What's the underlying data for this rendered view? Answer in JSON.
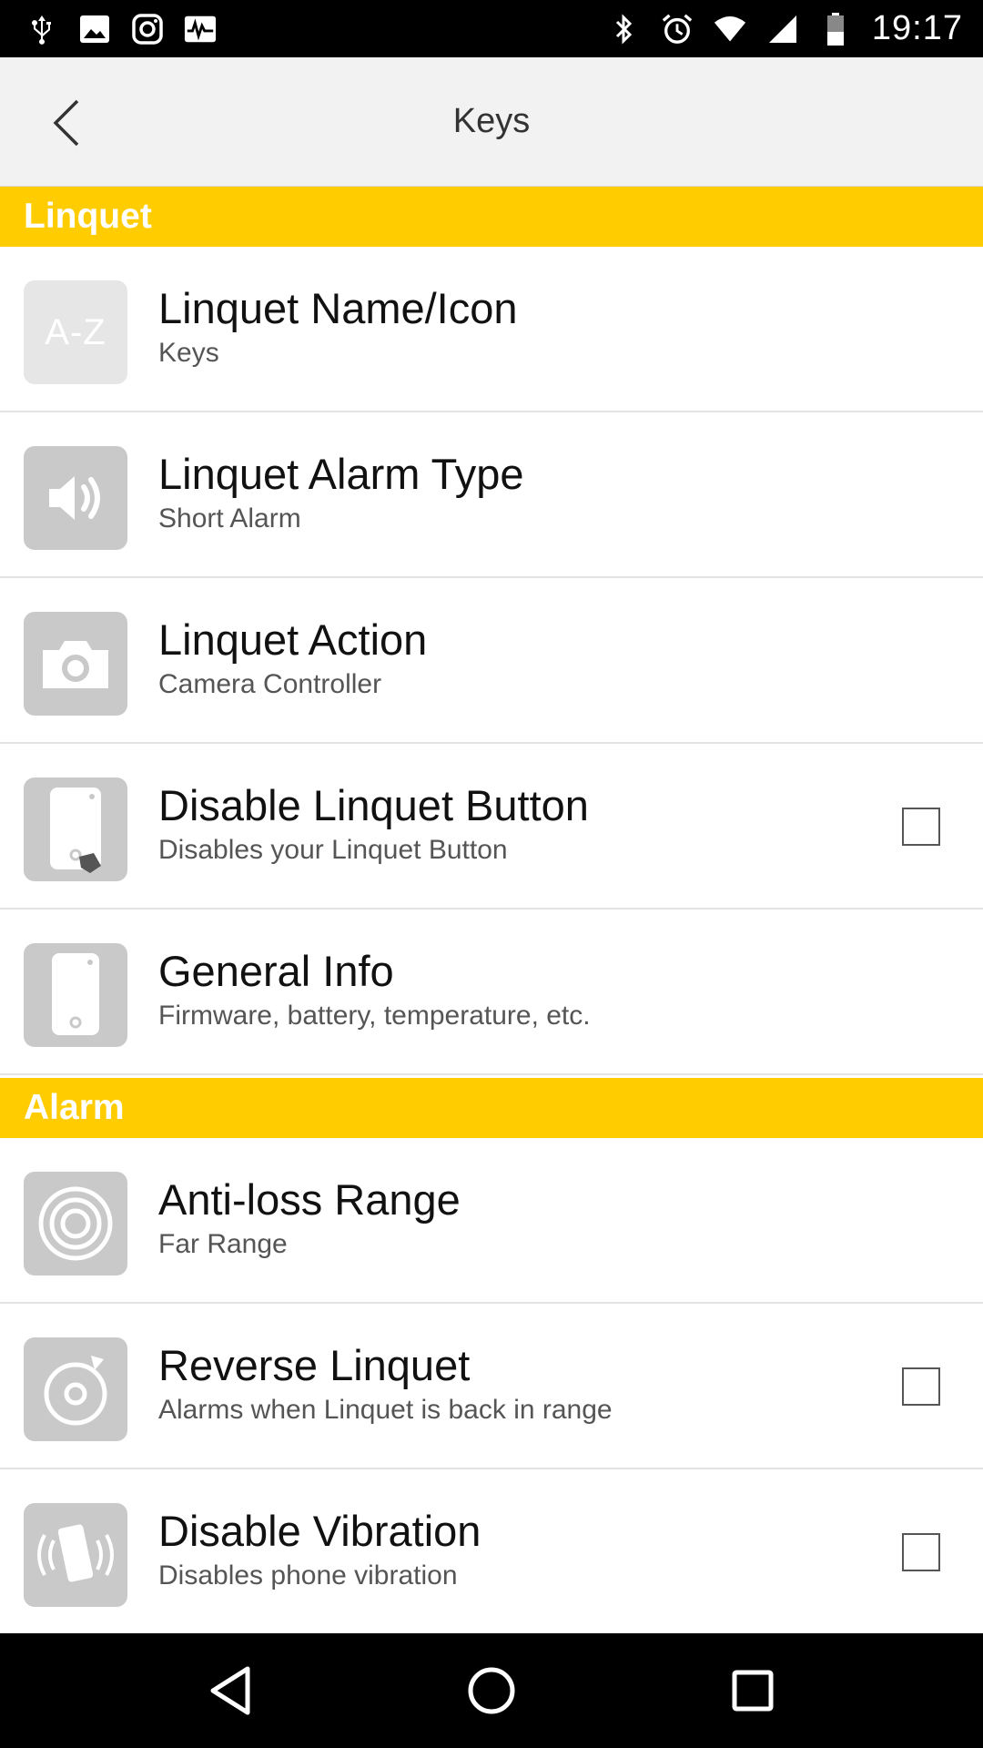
{
  "status_bar": {
    "time": "19:17",
    "left_icons": [
      "usb-icon",
      "image-icon",
      "instagram-icon",
      "activity-icon"
    ],
    "right_icons": [
      "bluetooth-icon",
      "alarm-clock-icon",
      "wifi-icon",
      "signal-icon",
      "battery-icon"
    ]
  },
  "app_bar": {
    "title": "Keys",
    "back_icon": "chevron-left-icon"
  },
  "sections": [
    {
      "header": "Linquet",
      "items": [
        {
          "title": "Linquet Name/Icon",
          "subtitle": "Keys",
          "icon": "a-z-icon",
          "icon_text": "A-Z",
          "has_checkbox": false
        },
        {
          "title": "Linquet Alarm Type",
          "subtitle": "Short Alarm",
          "icon": "speaker-icon",
          "has_checkbox": false
        },
        {
          "title": "Linquet Action",
          "subtitle": "Camera Controller",
          "icon": "camera-icon",
          "has_checkbox": false
        },
        {
          "title": "Disable Linquet Button",
          "subtitle": "Disables your Linquet Button",
          "icon": "device-press-icon",
          "has_checkbox": true,
          "checked": false
        },
        {
          "title": "General Info",
          "subtitle": "Firmware, battery, temperature, etc.",
          "icon": "device-icon",
          "has_checkbox": false
        }
      ]
    },
    {
      "header": "Alarm",
      "items": [
        {
          "title": "Anti-loss Range",
          "subtitle": "Far Range",
          "icon": "range-icon",
          "has_checkbox": false
        },
        {
          "title": "Reverse Linquet",
          "subtitle": "Alarms when Linquet is back in range",
          "icon": "reverse-icon",
          "has_checkbox": true,
          "checked": false
        },
        {
          "title": "Disable Vibration",
          "subtitle": "Disables phone vibration",
          "icon": "vibration-icon",
          "has_checkbox": true,
          "checked": false
        }
      ]
    }
  ],
  "nav_bar": [
    "back-triangle-icon",
    "home-circle-icon",
    "recents-square-icon"
  ],
  "colors": {
    "section_header": "#ffcc00",
    "app_bar": "#f2f2f2",
    "icon_tile": "#c9c9c9"
  }
}
